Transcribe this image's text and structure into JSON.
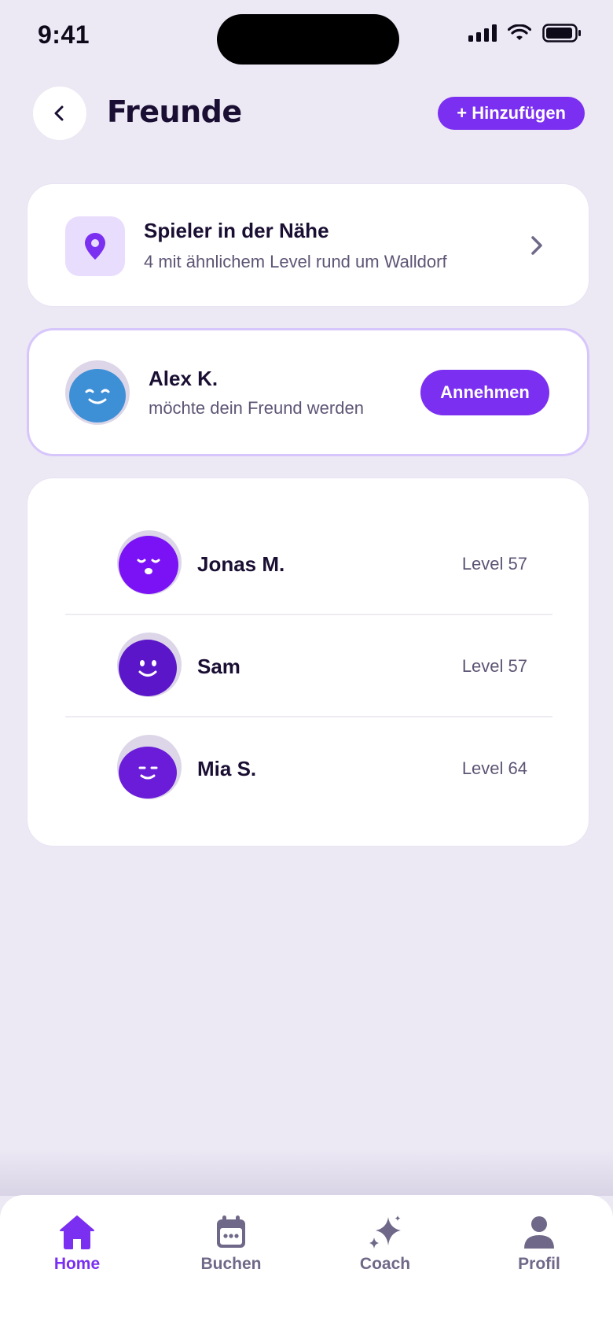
{
  "status_bar": {
    "time": "9:41"
  },
  "header": {
    "title": "Freunde",
    "add_label": "+ Hinzufügen"
  },
  "nearby": {
    "title": "Spieler in der Nähe",
    "subtitle": "4 mit ähnlichem Level rund um Walldorf"
  },
  "request": {
    "name": "Alex K.",
    "message": "möchte dein Freund werden",
    "accept_label": "Annehmen"
  },
  "friends": [
    {
      "name": "Jonas M.",
      "level": "Level 57",
      "avatar_color": "#7A12F5"
    },
    {
      "name": "Sam",
      "level": "Level 57",
      "avatar_color": "#5B16C9"
    },
    {
      "name": "Mia S.",
      "level": "Level 64",
      "avatar_color": "#6A1CD8"
    }
  ],
  "nav": {
    "items": [
      {
        "label": "Home",
        "icon": "home-icon",
        "active": true
      },
      {
        "label": "Buchen",
        "icon": "calendar-icon",
        "active": false
      },
      {
        "label": "Coach",
        "icon": "sparkle-icon",
        "active": false
      },
      {
        "label": "Profil",
        "icon": "person-icon",
        "active": false
      }
    ]
  },
  "colors": {
    "accent": "#7B2FF0",
    "background": "#ECE8F4",
    "request_avatar": "#3D8FD6",
    "request_border": "#D7C6FB"
  }
}
